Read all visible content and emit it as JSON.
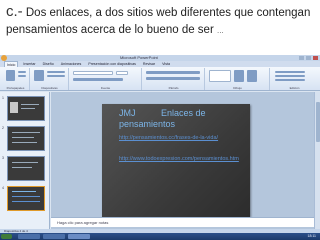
{
  "caption": {
    "lead": "c.-",
    "text": " Dos enlaces,  a dos sitios web diferentes que contengan pensamientos acerca de lo bueno de ser",
    "trail": "..."
  },
  "window": {
    "title": "Microsoft PowerPoint",
    "tabs": [
      "Inicio",
      "Insertar",
      "Diseño",
      "Animaciones",
      "Presentación con diapositivas",
      "Revisar",
      "Vista"
    ],
    "ribbon_groups": [
      "Portapapeles",
      "Diapositivas",
      "Fuente",
      "Párrafo",
      "Dibujo",
      "Edición"
    ]
  },
  "thumbnails": [
    {
      "num": "1"
    },
    {
      "num": "2"
    },
    {
      "num": "3"
    },
    {
      "num": "4"
    }
  ],
  "slide": {
    "jmj": "JMJ",
    "title_line1": "Enlaces de",
    "title_line2": "pensamientos",
    "link1": "http://pensamientos.cc/frases-de-la-vida/",
    "link2": "http://www.todoexpresion.com/pensamientos.htm"
  },
  "notes": {
    "placeholder": "Haga clic para agregar notas"
  },
  "statusbar": {
    "text": "Diapositiva 4 de 4"
  },
  "taskbar": {
    "clock": "18:11"
  },
  "colors": {
    "accent_link": "#5b8fd0",
    "title_blue": "#7cb5e8",
    "slide_bg": "#3a3a3a"
  }
}
